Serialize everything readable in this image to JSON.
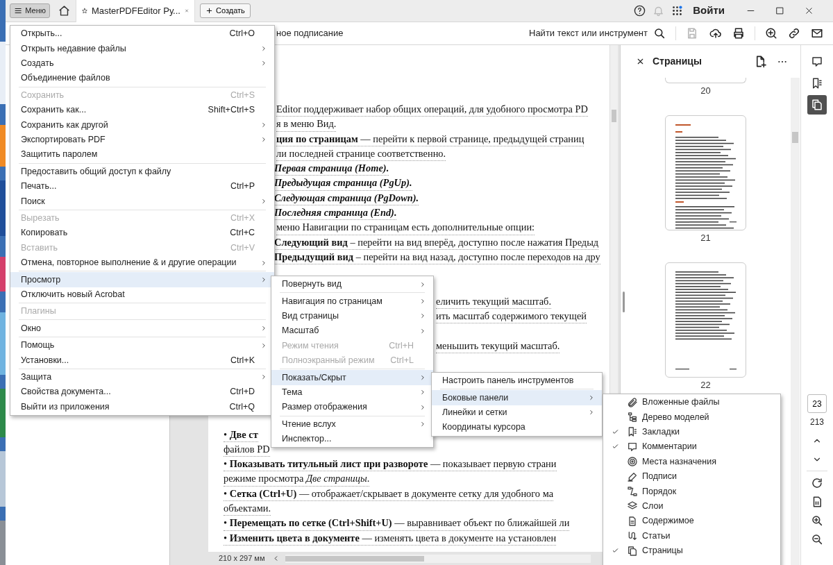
{
  "top_bar": {
    "menu_button": "Меню",
    "tab_title": "MasterPDFEditor Ру...",
    "new_button": "Создать",
    "sign_in": "Войти"
  },
  "toolbar": {
    "partial_label": "ное подписание",
    "search_label": "Найти текст или инструмент",
    "save_disabled": true
  },
  "document": {
    "lines": [
      {
        "kind": "plain",
        "text": "Editor поддерживает набор общих операций, для удобного просмотра PD"
      },
      {
        "kind": "plain",
        "text": "я в меню Вид."
      },
      {
        "kind": "plain",
        "text": "**ция по страницам** — перейти к первой странице, предыдущей страниц"
      },
      {
        "kind": "plain",
        "text": "ли последней странице соответственно."
      },
      {
        "kind": "emphasis",
        "text": "Первая страница (Home)."
      },
      {
        "kind": "emphasis",
        "text": "Предыдущая страница (PgUp)."
      },
      {
        "kind": "emphasis",
        "text": "Следующая страница (PgDown)."
      },
      {
        "kind": "emphasis",
        "text": "Последняя страница (End)."
      },
      {
        "kind": "plain",
        "text": "меню Навигации по страницам есть дополнительные опции:"
      },
      {
        "kind": "plain",
        "text": "**Следующий вид** – перейти на вид вперёд, доступно после нажатия Предыд"
      },
      {
        "kind": "plain",
        "text": "**Предыдущий вид** – перейти на вид назад, доступно после переходов на дру"
      },
      {
        "kind": "plain",
        "text": "еличить текущий масштаб."
      },
      {
        "kind": "plain",
        "text": "ить масштаб содержимого текущей"
      },
      {
        "kind": "plain",
        "text": "меньшить текущий масштаб."
      },
      {
        "kind": "plain",
        "text": "• **Две ст**"
      },
      {
        "kind": "plain",
        "text": "файлов PD"
      },
      {
        "kind": "plain",
        "text": "• **Показывать титульный лист при развороте** — показывает первую страни"
      },
      {
        "kind": "plain",
        "text": "режиме просмотра *Две страницы*."
      },
      {
        "kind": "plain",
        "text": "• **Сетка (Ctrl+U)** — отображает/скрывает в документе сетку для удобного ма"
      },
      {
        "kind": "plain",
        "text": "объектами."
      },
      {
        "kind": "plain",
        "text": "• **Перемещать по сетке (Ctrl+Shift+U)** — выравнивает объект по ближайшей ли"
      },
      {
        "kind": "plain",
        "text": "• **Изменить цвета в документе** — изменять цвета в документе на установлен"
      }
    ],
    "page_size": "210 x 297 мм"
  },
  "pages_panel": {
    "title": "Страницы",
    "thumbnails": [
      {
        "label": "20"
      },
      {
        "label": "21"
      },
      {
        "label": "22"
      }
    ]
  },
  "right_toolbar": {
    "panel_buttons": [
      {
        "selected": false
      },
      {
        "selected": false
      },
      {
        "selected": true
      }
    ],
    "page_number": "23",
    "page_count": "213"
  },
  "menus": [
    {
      "items": [
        {
          "kind": "item",
          "label": "Открыть...",
          "shortcut": "Ctrl+O",
          "submenu": false,
          "disabled": false,
          "selected": false
        },
        {
          "kind": "item",
          "label": "Открыть недавние файлы",
          "submenu": true,
          "disabled": false,
          "selected": false
        },
        {
          "kind": "item",
          "label": "Создать",
          "submenu": true,
          "disabled": false,
          "selected": false
        },
        {
          "kind": "item",
          "label": "Объединение файлов",
          "submenu": false,
          "disabled": false,
          "selected": false
        },
        {
          "kind": "separator"
        },
        {
          "kind": "item",
          "label": "Сохранить",
          "shortcut": "Ctrl+S",
          "submenu": false,
          "disabled": true,
          "selected": false
        },
        {
          "kind": "item",
          "label": "Сохранить как...",
          "shortcut": "Shift+Ctrl+S",
          "submenu": false,
          "disabled": false,
          "selected": false
        },
        {
          "kind": "item",
          "label": "Сохранить как другой",
          "submenu": true,
          "disabled": false,
          "selected": false
        },
        {
          "kind": "item",
          "label": "Экспортировать PDF",
          "submenu": true,
          "disabled": false,
          "selected": false
        },
        {
          "kind": "item",
          "label": "Защитить паролем",
          "submenu": false,
          "disabled": false,
          "selected": false
        },
        {
          "kind": "separator"
        },
        {
          "kind": "item",
          "label": "Предоставить общий доступ к файлу",
          "submenu": false,
          "disabled": false,
          "selected": false
        },
        {
          "kind": "item",
          "label": "Печать...",
          "shortcut": "Ctrl+P",
          "submenu": false,
          "disabled": false,
          "selected": false
        },
        {
          "kind": "item",
          "label": "Поиск",
          "submenu": true,
          "disabled": false,
          "selected": false
        },
        {
          "kind": "separator"
        },
        {
          "kind": "item",
          "label": "Вырезать",
          "shortcut": "Ctrl+X",
          "submenu": false,
          "disabled": true,
          "selected": false
        },
        {
          "kind": "item",
          "label": "Копировать",
          "shortcut": "Ctrl+C",
          "submenu": false,
          "disabled": false,
          "selected": false
        },
        {
          "kind": "item",
          "label": "Вставить",
          "shortcut": "Ctrl+V",
          "submenu": false,
          "disabled": true,
          "selected": false
        },
        {
          "kind": "item",
          "label": "Отмена, повторное выполнение & и другие операции",
          "submenu": true,
          "disabled": false,
          "selected": false
        },
        {
          "kind": "separator"
        },
        {
          "kind": "item",
          "label": "Просмотр",
          "submenu": true,
          "disabled": false,
          "selected": true
        },
        {
          "kind": "item",
          "label": "Отключить новый Acrobat",
          "submenu": false,
          "disabled": false,
          "selected": false
        },
        {
          "kind": "separator"
        },
        {
          "kind": "item",
          "label": "Плагины",
          "submenu": false,
          "disabled": true,
          "selected": false
        },
        {
          "kind": "separator"
        },
        {
          "kind": "item",
          "label": "Окно",
          "submenu": true,
          "disabled": false,
          "selected": false
        },
        {
          "kind": "separator"
        },
        {
          "kind": "item",
          "label": "Помощь",
          "submenu": true,
          "disabled": false,
          "selected": false
        },
        {
          "kind": "item",
          "label": "Установки...",
          "shortcut": "Ctrl+K",
          "submenu": false,
          "disabled": false,
          "selected": false
        },
        {
          "kind": "separator"
        },
        {
          "kind": "item",
          "label": "Защита",
          "submenu": true,
          "disabled": false,
          "selected": false
        },
        {
          "kind": "item",
          "label": "Свойства документа...",
          "shortcut": "Ctrl+D",
          "submenu": false,
          "disabled": false,
          "selected": false
        },
        {
          "kind": "item",
          "label": "Выйти из приложения",
          "shortcut": "Ctrl+Q",
          "submenu": false,
          "disabled": false,
          "selected": false
        }
      ]
    },
    {
      "items": [
        {
          "kind": "item",
          "label": "Повернуть вид",
          "submenu": true,
          "disabled": false,
          "selected": false
        },
        {
          "kind": "separator"
        },
        {
          "kind": "item",
          "label": "Навигация по страницам",
          "submenu": true,
          "disabled": false,
          "selected": false
        },
        {
          "kind": "item",
          "label": "Вид страницы",
          "submenu": true,
          "disabled": false,
          "selected": false
        },
        {
          "kind": "item",
          "label": "Масштаб",
          "submenu": true,
          "disabled": false,
          "selected": false
        },
        {
          "kind": "item",
          "label": "Режим чтения",
          "shortcut": "Ctrl+H",
          "submenu": false,
          "disabled": true,
          "selected": false
        },
        {
          "kind": "item",
          "label": "Полноэкранный режим",
          "shortcut": "Ctrl+L",
          "submenu": false,
          "disabled": true,
          "selected": false
        },
        {
          "kind": "separator"
        },
        {
          "kind": "item",
          "label": "Показать/Скрыт",
          "submenu": true,
          "disabled": false,
          "selected": true
        },
        {
          "kind": "item",
          "label": "Тема",
          "submenu": true,
          "disabled": false,
          "selected": false
        },
        {
          "kind": "item",
          "label": "Размер отображения",
          "submenu": true,
          "disabled": false,
          "selected": false
        },
        {
          "kind": "separator"
        },
        {
          "kind": "item",
          "label": "Чтение вслух",
          "submenu": true,
          "disabled": false,
          "selected": false
        },
        {
          "kind": "item",
          "label": "Инспектор...",
          "submenu": false,
          "disabled": false,
          "selected": false
        }
      ]
    },
    {
      "items": [
        {
          "kind": "item",
          "label": "Настроить панель инструментов",
          "submenu": false,
          "disabled": false,
          "selected": false
        },
        {
          "kind": "separator"
        },
        {
          "kind": "item",
          "label": "Боковые панели",
          "submenu": true,
          "disabled": false,
          "selected": true
        },
        {
          "kind": "item",
          "label": "Линейки и сетки",
          "submenu": true,
          "disabled": false,
          "selected": false
        },
        {
          "kind": "item",
          "label": "Координаты курсора",
          "submenu": false,
          "disabled": false,
          "selected": false
        }
      ]
    },
    {
      "items": [
        {
          "kind": "item",
          "label": "Вложенные файлы",
          "submenu": false,
          "disabled": false,
          "selected": false,
          "checked": false
        },
        {
          "kind": "item",
          "label": "Дерево моделей",
          "submenu": false,
          "disabled": false,
          "selected": false,
          "checked": false
        },
        {
          "kind": "item",
          "label": "Закладки",
          "submenu": false,
          "disabled": false,
          "selected": false,
          "checked": true
        },
        {
          "kind": "item",
          "label": "Комментарии",
          "submenu": false,
          "disabled": false,
          "selected": false,
          "checked": true
        },
        {
          "kind": "item",
          "label": "Места назначения",
          "submenu": false,
          "disabled": false,
          "selected": false,
          "checked": false
        },
        {
          "kind": "item",
          "label": "Подписи",
          "submenu": false,
          "disabled": false,
          "selected": false,
          "checked": false
        },
        {
          "kind": "item",
          "label": "Порядок",
          "submenu": false,
          "disabled": false,
          "selected": false,
          "checked": false
        },
        {
          "kind": "item",
          "label": "Слои",
          "submenu": false,
          "disabled": false,
          "selected": false,
          "checked": false
        },
        {
          "kind": "item",
          "label": "Содержимое",
          "submenu": false,
          "disabled": false,
          "selected": false,
          "checked": false
        },
        {
          "kind": "item",
          "label": "Статьи",
          "submenu": false,
          "disabled": false,
          "selected": false,
          "checked": false
        },
        {
          "kind": "item",
          "label": "Страницы",
          "submenu": false,
          "disabled": false,
          "selected": false,
          "checked": true
        }
      ]
    }
  ]
}
